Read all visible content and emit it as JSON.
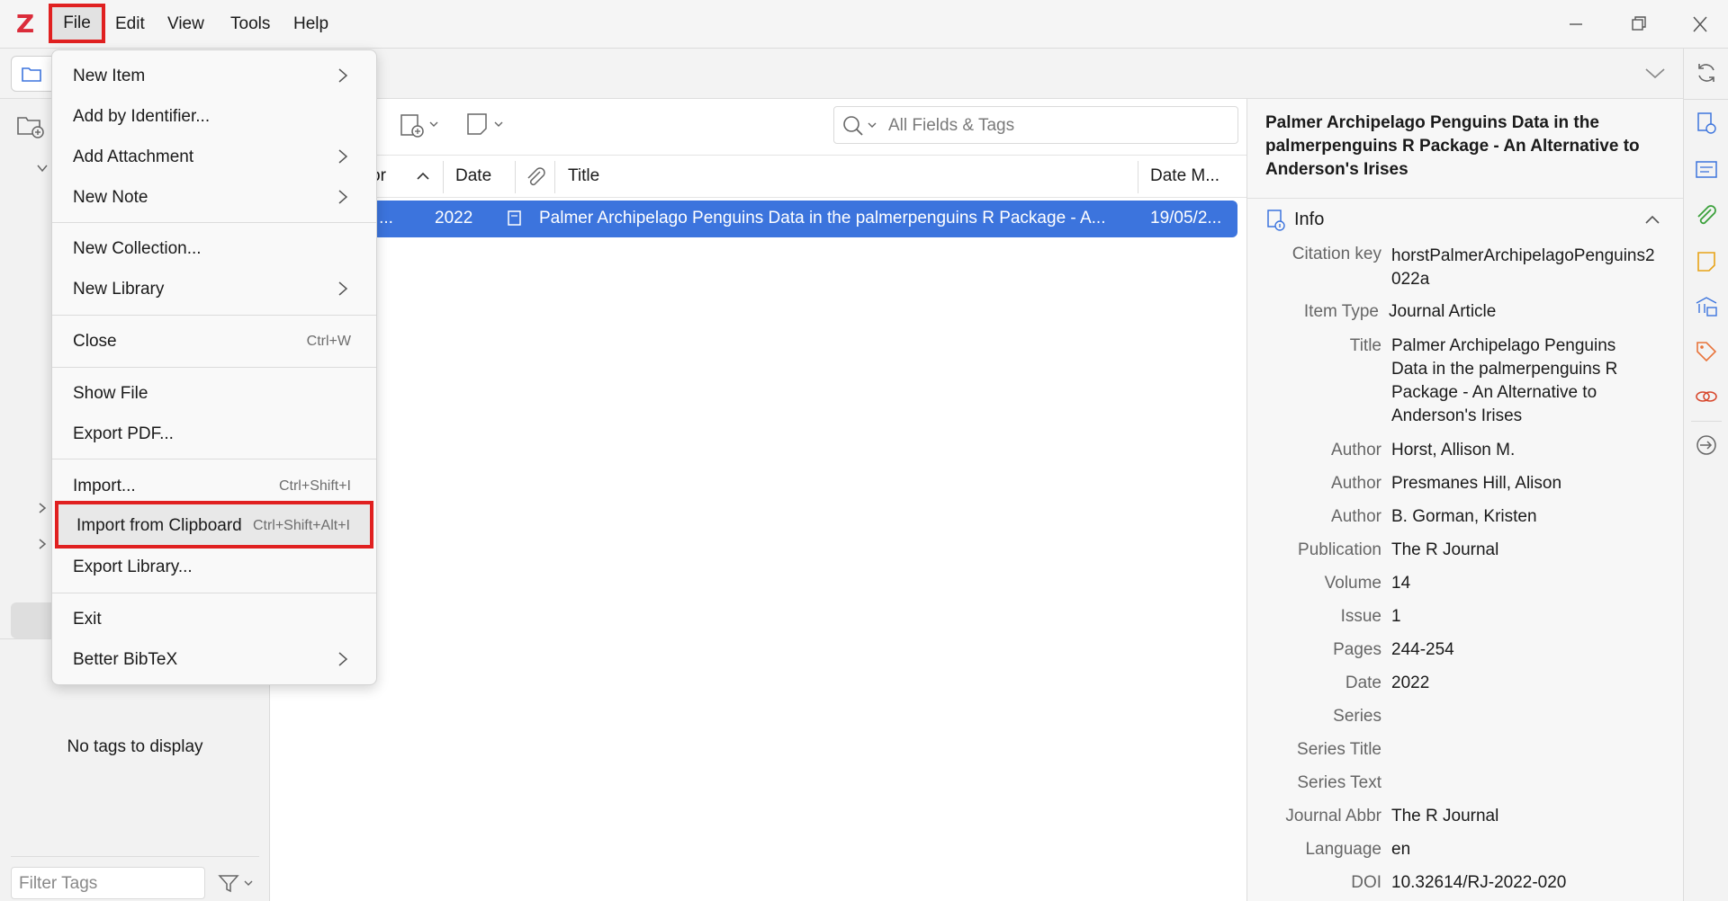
{
  "menubar": {
    "items": [
      "File",
      "Edit",
      "View",
      "Tools",
      "Help"
    ]
  },
  "file_menu": {
    "items": [
      {
        "label": "New Item",
        "submenu": true
      },
      {
        "label": "Add by Identifier..."
      },
      {
        "label": "Add Attachment",
        "submenu": true
      },
      {
        "label": "New Note",
        "submenu": true
      },
      {
        "label": "New Collection..."
      },
      {
        "label": "New Library",
        "submenu": true
      },
      {
        "label": "Close",
        "shortcut": "Ctrl+W"
      },
      {
        "label": "Show File"
      },
      {
        "label": "Export PDF..."
      },
      {
        "label": "Import...",
        "shortcut": "Ctrl+Shift+I"
      },
      {
        "label": "Import from Clipboard",
        "shortcut": "Ctrl+Shift+Alt+I"
      },
      {
        "label": "Export Library..."
      },
      {
        "label": "Exit"
      },
      {
        "label": "Better BibTeX",
        "submenu": true
      }
    ]
  },
  "search": {
    "placeholder": "All Fields & Tags"
  },
  "columns": {
    "creator": "or",
    "date": "Date",
    "title": "Title",
    "date_modified": "Date M..."
  },
  "row": {
    "creator": "et ...",
    "date": "2022",
    "title": "Palmer Archipelago Penguins Data in the palmerpenguins R Package - A...",
    "date_modified": "19/05/2..."
  },
  "tags": {
    "empty": "No tags to display",
    "filter_placeholder": "Filter Tags"
  },
  "item_pane": {
    "header_title": "Palmer Archipelago Penguins Data in the palmerpenguins R Package - An Alternative to Anderson's Irises",
    "section": "Info",
    "fields": [
      {
        "label": "Citation key",
        "value": "horstPalmerArchipelagoPenguins2022a"
      },
      {
        "label": "Item Type",
        "value": "Journal Article"
      },
      {
        "label": "Title",
        "value": "Palmer Archipelago Penguins Data in the palmerpenguins R Package - An Alternative to Anderson's Irises"
      },
      {
        "label": "Author",
        "value": "Horst, Allison M."
      },
      {
        "label": "Author",
        "value": "Presmanes Hill, Alison"
      },
      {
        "label": "Author",
        "value": "B. Gorman, Kristen"
      },
      {
        "label": "Publication",
        "value": "The R Journal"
      },
      {
        "label": "Volume",
        "value": "14"
      },
      {
        "label": "Issue",
        "value": "1"
      },
      {
        "label": "Pages",
        "value": "244-254"
      },
      {
        "label": "Date",
        "value": "2022"
      },
      {
        "label": "Series",
        "value": ""
      },
      {
        "label": "Series Title",
        "value": ""
      },
      {
        "label": "Series Text",
        "value": ""
      },
      {
        "label": "Journal Abbr",
        "value": "The R Journal"
      },
      {
        "label": "Language",
        "value": "en"
      },
      {
        "label": "DOI",
        "value": "10.32614/RJ-2022-020"
      }
    ]
  },
  "colors": {
    "accent": "#3c74dd",
    "highlight_border": "#e02020",
    "logo": "#db2c3a"
  }
}
